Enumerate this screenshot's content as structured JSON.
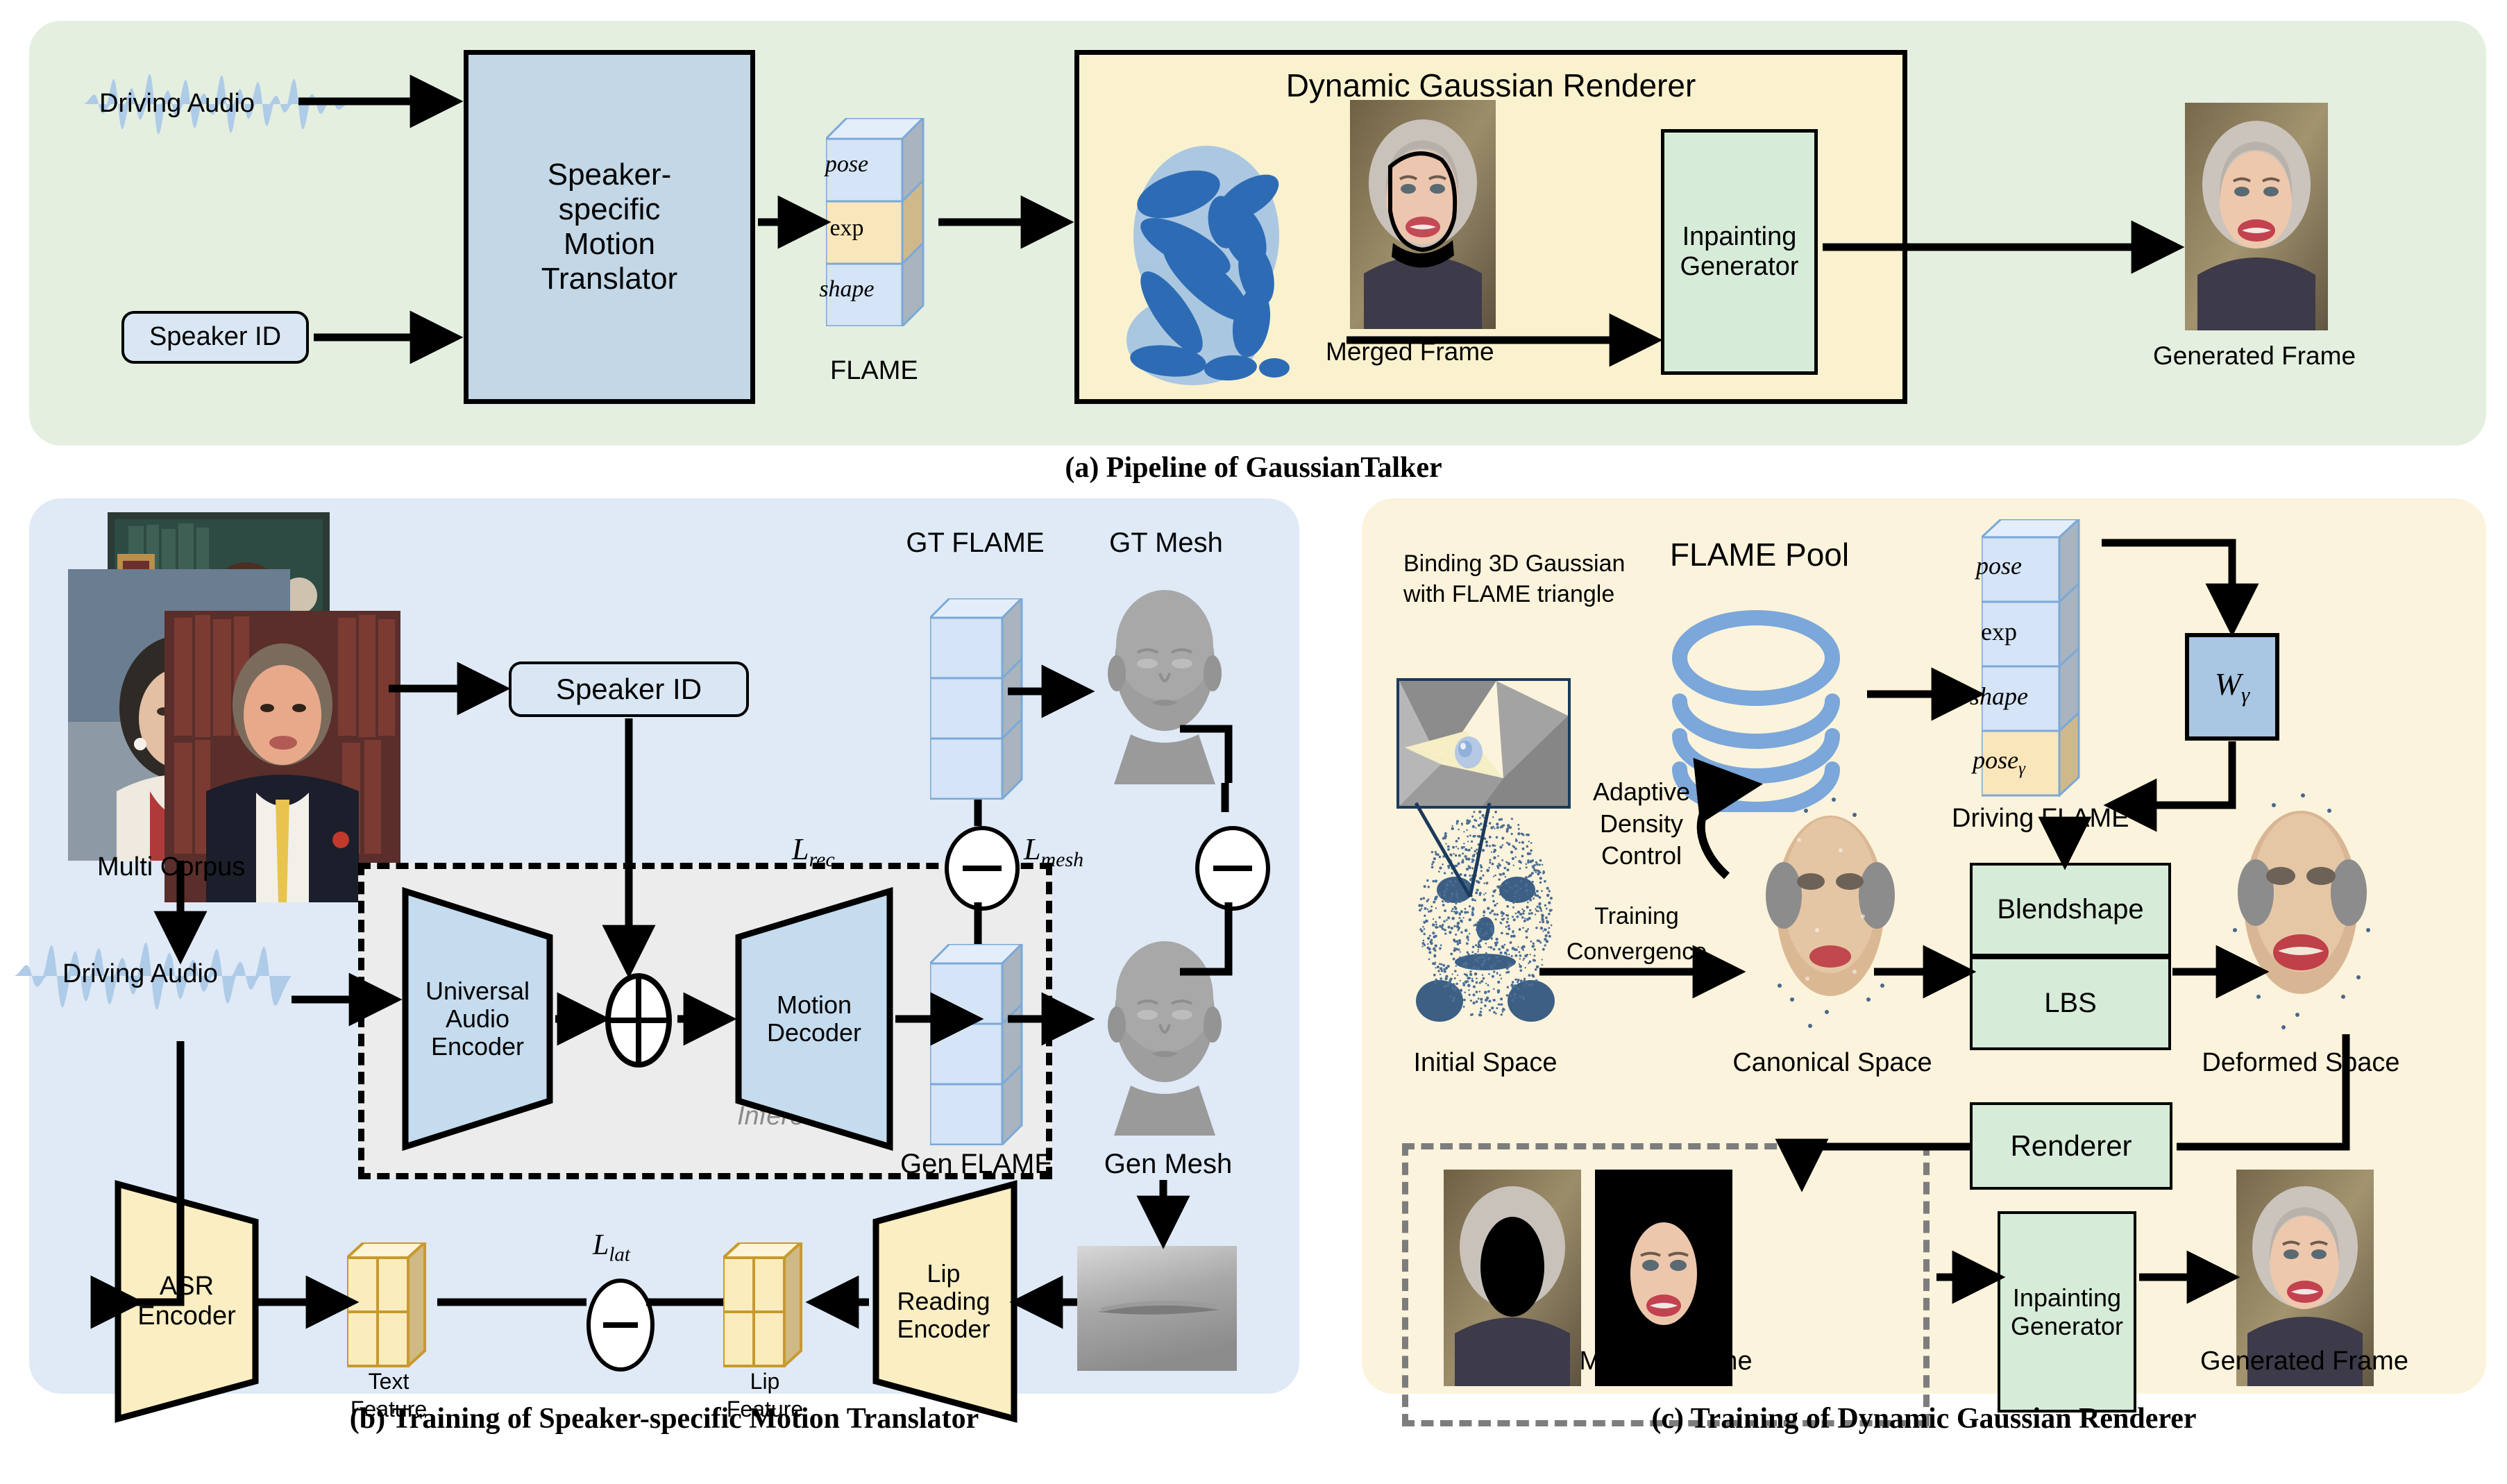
{
  "panels": {
    "a": {
      "caption": "(a) Pipeline of GaussianTalker"
    },
    "b": {
      "caption": "(b) Training of Speaker-specific Motion Translator"
    },
    "c": {
      "caption": "(c) Training of Dynamic Gaussian Renderer"
    }
  },
  "panel_a": {
    "driving_audio_label": "Driving Audio",
    "speaker_id_label": "Speaker ID",
    "translator_label": "Speaker-\nspecific\nMotion\nTranslator",
    "translator_lines": [
      "Speaker-",
      "specific",
      "Motion",
      "Translator"
    ],
    "flame_caption": "FLAME",
    "flame_slices": [
      "pose",
      "exp",
      "shape"
    ],
    "renderer_title": "Dynamic Gaussian Renderer",
    "merged_frame_label": "Merged  Frame",
    "inpainting_label_lines": [
      "Inpainting",
      "Generator"
    ],
    "generated_frame_label": "Generated Frame"
  },
  "panel_b": {
    "multi_corpus_label": "Multi Corpus",
    "driving_audio_label": "Driving Audio",
    "speaker_id_label": "Speaker ID",
    "universal_audio_encoder_lines": [
      "Universal",
      "Audio",
      "Encoder"
    ],
    "motion_decoder_lines": [
      "Motion",
      "Decoder"
    ],
    "inference_label": "Inference",
    "gt_flame_label": "GT FLAME",
    "gt_mesh_label": "GT Mesh",
    "gen_flame_label": "Gen FLAME",
    "gen_mesh_label": "Gen Mesh",
    "loss_rec": "L",
    "loss_rec_sub": "rec",
    "loss_mesh": "L",
    "loss_mesh_sub": "mesh",
    "loss_lat": "L",
    "loss_lat_sub": "lat",
    "asr_encoder_lines": [
      "ASR",
      "Encoder"
    ],
    "lip_reading_encoder_lines": [
      "Lip",
      "Reading",
      "Encoder"
    ],
    "text_feature_lines": [
      "Text",
      "Feature"
    ],
    "lip_feature_lines": [
      "Lip",
      "Feature"
    ]
  },
  "panel_c": {
    "binding_note_lines": [
      "Binding 3D Gaussian",
      "with FLAME triangle"
    ],
    "flame_pool_label": "FLAME Pool",
    "driving_flame_label": "Driving FLAME",
    "flame_slices": [
      "pose",
      "exp",
      "shape"
    ],
    "flame_slice_gamma": "pose",
    "flame_slice_gamma_sub": "γ",
    "w_gamma_label": "W",
    "w_gamma_sub": "γ",
    "adaptive_density_lines": [
      "Adaptive",
      "Density",
      "Control"
    ],
    "training_convergence_lines": [
      "Training",
      "Convergence"
    ],
    "initial_space_label": "Initial Space",
    "canonical_space_label": "Canonical Space",
    "deformed_space_label": "Deformed Space",
    "blendshape_label": "Blendshape",
    "lbs_label": "LBS",
    "renderer_label": "Renderer",
    "merged_frame_label": "Merged  Frame",
    "inpainting_label_lines": [
      "Inpainting",
      "Generator"
    ],
    "generated_frame_label": "Generated Frame"
  },
  "colors": {
    "panel_a_bg": "#e4efdf",
    "panel_b_bg": "#dfeaf6",
    "panel_c_bg": "#fcf3dc",
    "box_blue": "#c3d7e6",
    "box_blue_light": "#d9e7f5",
    "box_green": "#d7ecd8",
    "box_yellow": "#faf2cf",
    "gaussian_blue": "#2d6cb5",
    "waveform_blue": "#aecbe8"
  }
}
